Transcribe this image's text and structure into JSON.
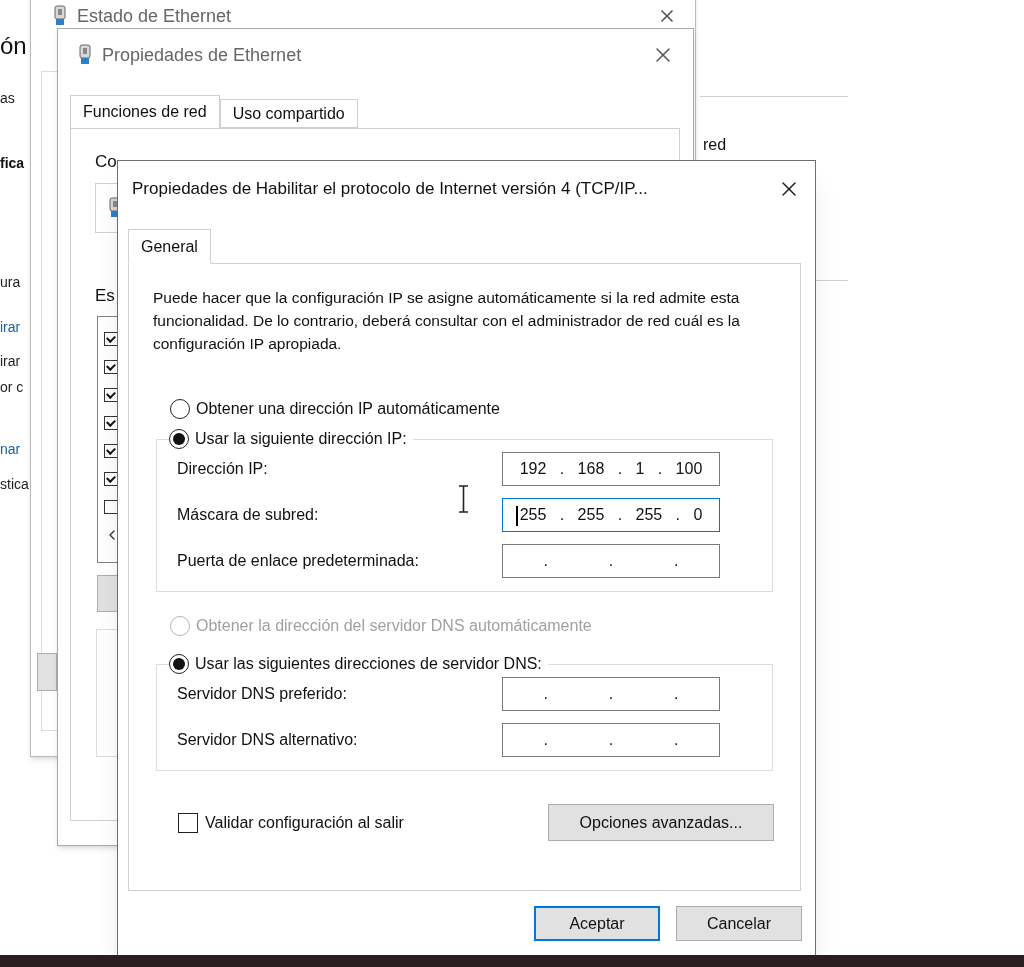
{
  "background_page": {
    "texts": [
      {
        "kind": "heading",
        "text": "ón"
      },
      {
        "kind": "text",
        "text": "as"
      },
      {
        "kind": "bold",
        "text": "fica"
      },
      {
        "kind": "text",
        "text": "ura"
      },
      {
        "kind": "link",
        "text": "irar"
      },
      {
        "kind": "text",
        "text": "irar"
      },
      {
        "kind": "text",
        "text": "or c"
      },
      {
        "kind": "link",
        "text": "nar"
      },
      {
        "kind": "text",
        "text": "stica"
      }
    ],
    "side_text": "red"
  },
  "status_window": {
    "title": "Estado de Ethernet"
  },
  "ethernet_window": {
    "title": "Propiedades de Ethernet",
    "tabs": [
      {
        "label": "Funciones de red",
        "selected": true
      },
      {
        "label": "Uso compartido",
        "selected": false
      }
    ],
    "connect_label": "Co",
    "components_label": "Es",
    "components": [
      {
        "checked": true
      },
      {
        "checked": true
      },
      {
        "checked": true
      },
      {
        "checked": true
      },
      {
        "checked": true
      },
      {
        "checked": true
      },
      {
        "checked": false
      }
    ]
  },
  "ipv4_dialog": {
    "title": "Propiedades de Habilitar el protocolo de Internet versión 4 (TCP/IP...",
    "tabs": [
      {
        "label": "General",
        "selected": true
      }
    ],
    "description": "Puede hacer que la configuración IP se asigne automáticamente si la red admite esta funcionalidad. De lo contrario, deberá consultar con el administrador de red cuál es la configuración IP apropiada.",
    "ip_auto": {
      "label": "Obtener una dirección IP automáticamente",
      "selected": false,
      "disabled": false
    },
    "ip_manual": {
      "label": "Usar la siguiente dirección IP:",
      "selected": true,
      "disabled": false
    },
    "ip_fields": [
      {
        "label": "Dirección IP:",
        "parts": [
          "192",
          ".",
          "168",
          ".",
          "1",
          ".",
          "100"
        ],
        "focused": false
      },
      {
        "label": "Máscara de subred:",
        "parts": [
          "255",
          ".",
          "255",
          ".",
          "255",
          ".",
          "0"
        ],
        "focused": true
      },
      {
        "label": "Puerta de enlace predeterminada:",
        "parts": [
          ".",
          ".",
          "."
        ],
        "focused": false
      }
    ],
    "dns_auto": {
      "label": "Obtener la dirección del servidor DNS automáticamente",
      "selected": false,
      "disabled": true
    },
    "dns_manual": {
      "label": "Usar las siguientes direcciones de servidor DNS:",
      "selected": true,
      "disabled": false
    },
    "dns_fields": [
      {
        "label": "Servidor DNS preferido:",
        "parts": [
          ".",
          ".",
          "."
        ],
        "focused": false
      },
      {
        "label": "Servidor DNS alternativo:",
        "parts": [
          ".",
          ".",
          "."
        ],
        "focused": false
      }
    ],
    "validate": {
      "label": "Validar configuración al salir",
      "checked": false
    },
    "advanced_button": "Opciones avanzadas...",
    "buttons": [
      {
        "label": "Aceptar",
        "focused": true
      },
      {
        "label": "Cancelar",
        "focused": false
      }
    ]
  }
}
